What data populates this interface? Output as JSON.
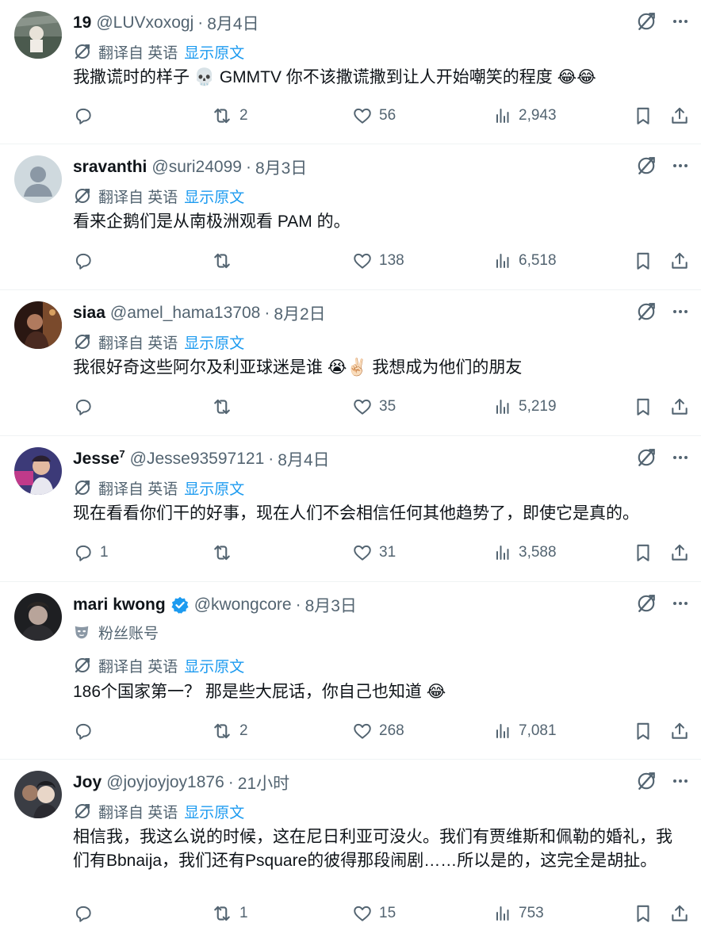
{
  "translate": {
    "label": "翻译自 英语",
    "link": "显示原文"
  },
  "tweets": [
    {
      "name": "19",
      "handle": "@LUVxoxogj",
      "time": "8月4日",
      "body": "我撒谎时的样子 💀 GMMTV 你不该撒谎撒到让人开始嘲笑的程度",
      "body_emoji_suffix": "😂😂",
      "replies": "",
      "retweets": "2",
      "likes": "56",
      "views": "2,943"
    },
    {
      "name": "sravanthi",
      "handle": "@suri24099",
      "time": "8月3日",
      "body": "看来企鹅们是从南极洲观看 PAM 的。",
      "replies": "",
      "retweets": "",
      "likes": "138",
      "views": "6,518"
    },
    {
      "name": "siaa",
      "handle": "@amel_hama13708",
      "time": "8月2日",
      "body_part1": "我很好奇这些阿尔及利亚球迷是谁",
      "body_emoji_mid": "😭✌🏻",
      "body_part2": "我想成为他们的朋友",
      "replies": "",
      "retweets": "",
      "likes": "35",
      "views": "5,219"
    },
    {
      "name": "Jesse",
      "name_sup": "7",
      "handle": "@Jesse93597121",
      "time": "8月4日",
      "body": "现在看看你们干的好事，现在人们不会相信任何其他趋势了，即使它是真的。",
      "replies": "1",
      "retweets": "",
      "likes": "31",
      "views": "3,588"
    },
    {
      "name": "mari kwong",
      "verified": true,
      "handle": "@kwongcore",
      "time": "8月3日",
      "fan_label": "粉丝账号",
      "body": "186个国家第一？ 那是些大屁话，你自己也知道",
      "body_emoji_suffix": "😂",
      "replies": "",
      "retweets": "2",
      "likes": "268",
      "views": "7,081"
    },
    {
      "name": "Joy",
      "handle": "@joyjoyjoy1876",
      "time": "21小时",
      "body": "相信我，我这么说的时候，这在尼日利亚可没火。我们有贾维斯和佩勒的婚礼，我们有Bbnaija，我们还有Psquare的彼得那段闹剧……所以是的，这完全是胡扯。",
      "replies": "",
      "retweets": "1",
      "likes": "15",
      "views": "753"
    }
  ],
  "colors": {
    "text": "#0f1419",
    "secondary": "#536471",
    "link": "#1d9bf0",
    "verified": "#1d9bf0",
    "divider": "#eff3f4"
  }
}
